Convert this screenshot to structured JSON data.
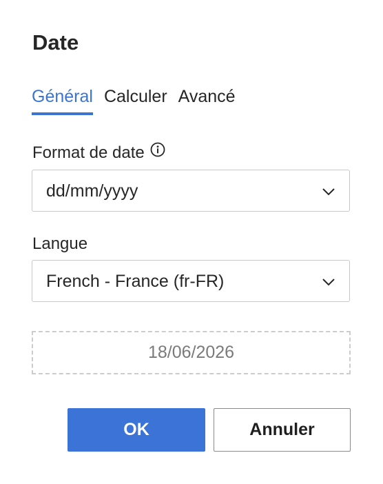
{
  "dialog": {
    "title": "Date"
  },
  "tabs": [
    {
      "label": "Général",
      "active": true
    },
    {
      "label": "Calculer",
      "active": false
    },
    {
      "label": "Avancé",
      "active": false
    }
  ],
  "date_format": {
    "label": "Format de date",
    "info_icon": "info-circle-icon",
    "value": "dd/mm/yyyy",
    "chevron_icon": "chevron-down-icon"
  },
  "language": {
    "label": "Langue",
    "value": "French - France (fr-FR)",
    "chevron_icon": "chevron-down-icon"
  },
  "preview": {
    "value": "18/06/2026"
  },
  "buttons": {
    "ok_label": "OK",
    "cancel_label": "Annuler"
  },
  "colors": {
    "accent": "#3b74d6",
    "tab_active": "#3b74d1",
    "text": "#262626",
    "preview_text": "#7a7a7a"
  }
}
